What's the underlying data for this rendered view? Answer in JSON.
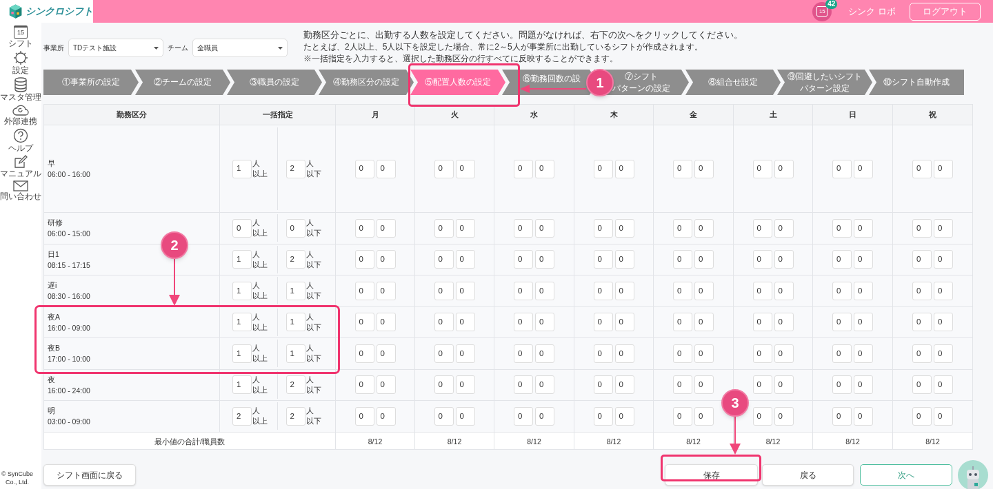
{
  "app": {
    "logo_text": "シンクロシフト",
    "calendar_day": "15",
    "notification_count": "42",
    "user_name": "シンク ロボ",
    "logout": "ログアウト"
  },
  "sidebar": {
    "items": [
      {
        "kind": "calendar",
        "label": "シフト",
        "icon_text": "15"
      },
      {
        "kind": "gear",
        "label": "設定"
      },
      {
        "kind": "database",
        "label": "マスタ管理"
      },
      {
        "kind": "cloud",
        "label": "外部連携"
      },
      {
        "kind": "help",
        "label": "ヘルプ"
      },
      {
        "kind": "edit",
        "label": "マニュアル"
      },
      {
        "kind": "mail",
        "label": "問い合わせ"
      }
    ],
    "copyright": "© SynCube Co., Ltd."
  },
  "filters": [
    {
      "label": "事業所",
      "value": "TDテスト施設"
    },
    {
      "label": "チーム",
      "value": "全職員"
    }
  ],
  "instructions": [
    "勤務区分ごとに、出勤する人数を設定してください。問題がなければ、右下の次へをクリックしてください。",
    "たとえば、2人以上、5人以下を設定した場合、常に2～5人が事業所に出勤しているシフトが作成されます。",
    "※一括指定を入力すると、選択した勤務区分の行すべてに反映することができます。"
  ],
  "steps": [
    {
      "label": "①事業所の設定",
      "selected": false
    },
    {
      "label": "②チームの設定",
      "selected": false
    },
    {
      "label": "③職員の設定",
      "selected": false
    },
    {
      "label": "④勤務区分の設定",
      "selected": false
    },
    {
      "label": "⑤配置人数の設定",
      "selected": true
    },
    {
      "label": "⑥勤務回数の設",
      "selected": false
    },
    {
      "lines": [
        "⑦シフト",
        "パターンの設定"
      ],
      "selected": false
    },
    {
      "label": "⑧組合せ設定",
      "selected": false
    },
    {
      "lines": [
        "⑨回避したいシフト",
        "パターン設定"
      ],
      "selected": false
    },
    {
      "label": "⑩シフト自動作成",
      "selected": false
    }
  ],
  "table": {
    "columns": [
      "勤務区分",
      "一括指定",
      "月",
      "火",
      "水",
      "木",
      "金",
      "土",
      "日",
      "祝"
    ],
    "rows": [
      {
        "name": "早",
        "time": "06:00 - 16:00",
        "min": "1",
        "min_unit": "人以上",
        "max": "2",
        "max_unit": "人以下",
        "days": [
          [
            "0",
            "0"
          ],
          [
            "0",
            "0"
          ],
          [
            "0",
            "0"
          ],
          [
            "0",
            "0"
          ],
          [
            "0",
            "0"
          ],
          [
            "0",
            "0"
          ],
          [
            "0",
            "0"
          ],
          [
            "0",
            "0"
          ]
        ]
      },
      {
        "name": "研修",
        "time": "06:00 - 15:00",
        "min": "0",
        "min_unit": "人以上",
        "max": "0",
        "max_unit": "人以下",
        "days": [
          [
            "0",
            "0"
          ],
          [
            "0",
            "0"
          ],
          [
            "0",
            "0"
          ],
          [
            "0",
            "0"
          ],
          [
            "0",
            "0"
          ],
          [
            "0",
            "0"
          ],
          [
            "0",
            "0"
          ],
          [
            "0",
            "0"
          ]
        ]
      },
      {
        "name": "日1",
        "time": "08:15 - 17:15",
        "min": "1",
        "min_unit": "人以上",
        "max": "2",
        "max_unit": "人以下",
        "days": [
          [
            "0",
            "0"
          ],
          [
            "0",
            "0"
          ],
          [
            "0",
            "0"
          ],
          [
            "0",
            "0"
          ],
          [
            "0",
            "0"
          ],
          [
            "0",
            "0"
          ],
          [
            "0",
            "0"
          ],
          [
            "0",
            "0"
          ]
        ]
      },
      {
        "name": "遅i",
        "time": "08:30 - 16:00",
        "min": "1",
        "min_unit": "人以上",
        "max": "1",
        "max_unit": "人以下",
        "days": [
          [
            "0",
            "0"
          ],
          [
            "0",
            "0"
          ],
          [
            "0",
            "0"
          ],
          [
            "0",
            "0"
          ],
          [
            "0",
            "0"
          ],
          [
            "0",
            "0"
          ],
          [
            "0",
            "0"
          ],
          [
            "0",
            "0"
          ]
        ]
      },
      {
        "name": "夜A",
        "time": "16:00 - 09:00",
        "min": "1",
        "min_unit": "人以上",
        "max": "1",
        "max_unit": "人以下",
        "days": [
          [
            "0",
            "0"
          ],
          [
            "0",
            "0"
          ],
          [
            "0",
            "0"
          ],
          [
            "0",
            "0"
          ],
          [
            "0",
            "0"
          ],
          [
            "0",
            "0"
          ],
          [
            "0",
            "0"
          ],
          [
            "0",
            "0"
          ]
        ]
      },
      {
        "name": "夜B",
        "time": "17:00 - 10:00",
        "min": "1",
        "min_unit": "人以上",
        "max": "1",
        "max_unit": "人以下",
        "days": [
          [
            "0",
            "0"
          ],
          [
            "0",
            "0"
          ],
          [
            "0",
            "0"
          ],
          [
            "0",
            "0"
          ],
          [
            "0",
            "0"
          ],
          [
            "0",
            "0"
          ],
          [
            "0",
            "0"
          ],
          [
            "0",
            "0"
          ]
        ]
      },
      {
        "name": "夜",
        "time": "16:00 - 24:00",
        "min": "1",
        "min_unit": "人以上",
        "max": "2",
        "max_unit": "人以下",
        "days": [
          [
            "0",
            "0"
          ],
          [
            "0",
            "0"
          ],
          [
            "0",
            "0"
          ],
          [
            "0",
            "0"
          ],
          [
            "0",
            "0"
          ],
          [
            "0",
            "0"
          ],
          [
            "0",
            "0"
          ],
          [
            "0",
            "0"
          ]
        ]
      },
      {
        "name": "明",
        "time": "03:00 - 09:00",
        "min": "2",
        "min_unit": "人以上",
        "max": "2",
        "max_unit": "人以下",
        "days": [
          [
            "0",
            "0"
          ],
          [
            "0",
            "0"
          ],
          [
            "0",
            "0"
          ],
          [
            "0",
            "0"
          ],
          [
            "0",
            "0"
          ],
          [
            "0",
            "0"
          ],
          [
            "0",
            "0"
          ],
          [
            "0",
            "0"
          ]
        ]
      }
    ],
    "footer": {
      "label": "最小値の合計/職員数",
      "totals": [
        "8/12",
        "8/12",
        "8/12",
        "8/12",
        "8/12",
        "8/12",
        "8/12",
        "8/12"
      ]
    }
  },
  "buttons": {
    "back_to_shift": "シフト画面に戻る",
    "save": "保存",
    "back": "戻る",
    "next": "次へ"
  },
  "annotations": [
    "1",
    "2",
    "3"
  ]
}
